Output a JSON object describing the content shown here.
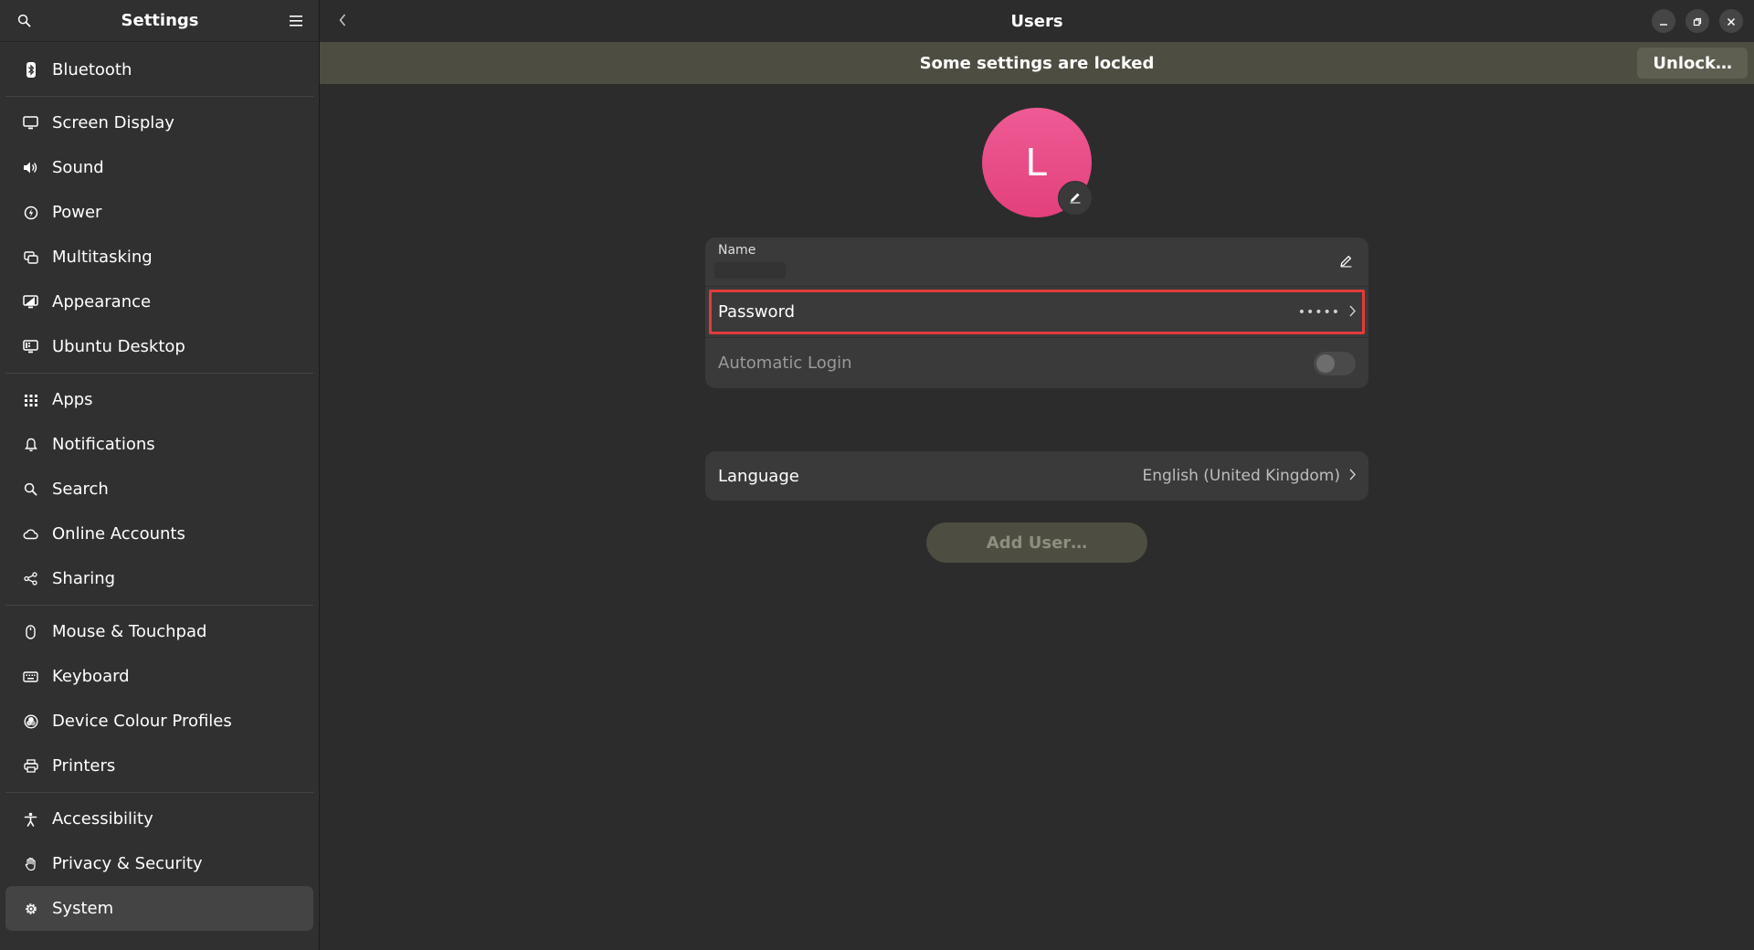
{
  "sidebar": {
    "title": "Settings",
    "items": [
      {
        "label": "Bluetooth",
        "icon": "bluetooth-icon"
      },
      {
        "label": "Screen Display",
        "icon": "display-icon"
      },
      {
        "label": "Sound",
        "icon": "speaker-icon"
      },
      {
        "label": "Power",
        "icon": "power-icon"
      },
      {
        "label": "Multitasking",
        "icon": "multitasking-icon"
      },
      {
        "label": "Appearance",
        "icon": "appearance-icon"
      },
      {
        "label": "Ubuntu Desktop",
        "icon": "ubuntu-desktop-icon"
      },
      {
        "label": "Apps",
        "icon": "apps-grid-icon"
      },
      {
        "label": "Notifications",
        "icon": "bell-icon"
      },
      {
        "label": "Search",
        "icon": "search-icon"
      },
      {
        "label": "Online Accounts",
        "icon": "cloud-icon"
      },
      {
        "label": "Sharing",
        "icon": "share-icon"
      },
      {
        "label": "Mouse & Touchpad",
        "icon": "mouse-icon"
      },
      {
        "label": "Keyboard",
        "icon": "keyboard-icon"
      },
      {
        "label": "Device Colour Profiles",
        "icon": "color-profile-icon"
      },
      {
        "label": "Printers",
        "icon": "printer-icon"
      },
      {
        "label": "Accessibility",
        "icon": "accessibility-icon"
      },
      {
        "label": "Privacy & Security",
        "icon": "hand-icon"
      },
      {
        "label": "System",
        "icon": "gear-icon"
      }
    ],
    "active": "System"
  },
  "header": {
    "title": "Users"
  },
  "lockbar": {
    "message": "Some settings are locked",
    "unlock_label": "Unlock…"
  },
  "user": {
    "avatar_letter": "L",
    "avatar_color": "#e9497f",
    "name_label": "Name",
    "password_label": "Password",
    "password_value": "•••••",
    "autologin_label": "Automatic Login",
    "autologin_enabled": false,
    "language_label": "Language",
    "language_value": "English (United Kingdom)"
  },
  "actions": {
    "add_user_label": "Add User…"
  },
  "colors": {
    "highlight": "#e23b3b",
    "lockbar_bg": "#4d4d41"
  }
}
